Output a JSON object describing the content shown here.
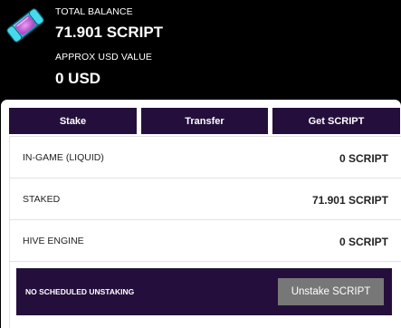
{
  "wallet": {
    "total_balance_label": "TOTAL BALANCE",
    "total_balance_value": "71.901 SCRIPT",
    "usd_label": "APPROX USD VALUE",
    "usd_value": "0 USD",
    "logo_icon": "script-token-capsule-icon"
  },
  "actions": {
    "stake": "Stake",
    "transfer": "Transfer",
    "get": "Get SCRIPT"
  },
  "balances": [
    {
      "label": "IN-GAME (LIQUID)",
      "value": "0 SCRIPT"
    },
    {
      "label": "STAKED",
      "value": "71.901 SCRIPT"
    },
    {
      "label": "HIVE ENGINE",
      "value": "0 SCRIPT"
    }
  ],
  "unstaking": {
    "status": "NO SCHEDULED UNSTAKING",
    "button": "Unstake SCRIPT"
  },
  "colors": {
    "accent": "#240f3c",
    "disabled_button": "#777777",
    "capsule": "#3fd6e8"
  }
}
